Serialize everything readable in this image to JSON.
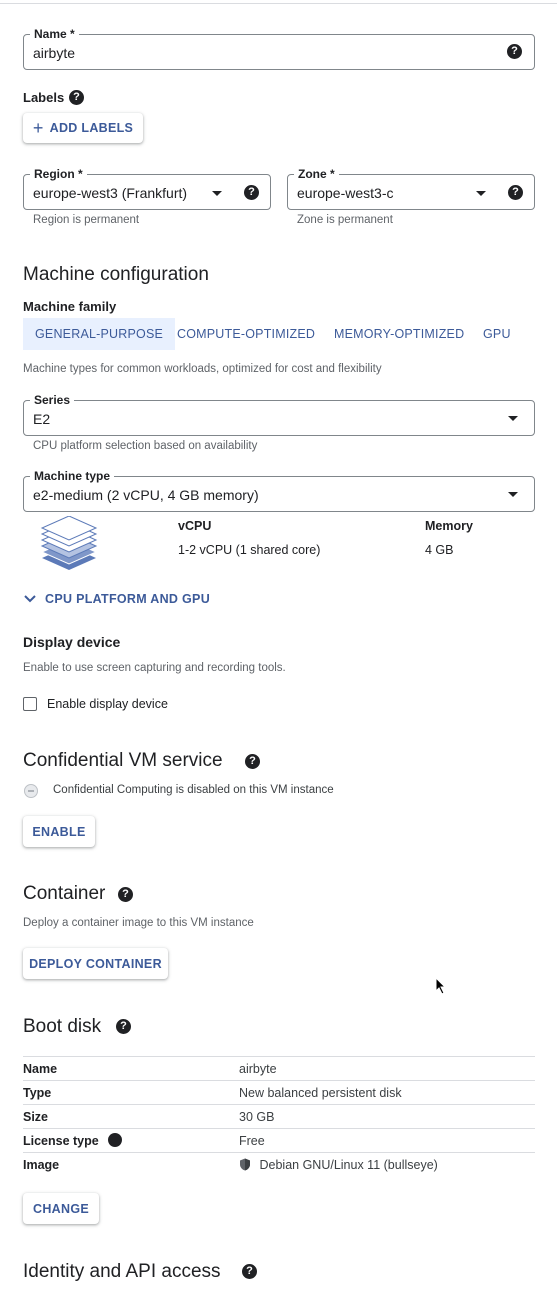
{
  "name_field": {
    "label": "Name *",
    "value": "airbyte",
    "help": "?"
  },
  "labels": {
    "title": "Labels",
    "help": "?",
    "add_button": "ADD LABELS"
  },
  "region": {
    "label": "Region *",
    "value": "europe-west3 (Frankfurt)",
    "hint": "Region is permanent",
    "help": "?"
  },
  "zone": {
    "label": "Zone *",
    "value": "europe-west3-c",
    "hint": "Zone is permanent",
    "help": "?"
  },
  "machine_config": {
    "title": "Machine configuration",
    "family_label": "Machine family",
    "tabs": [
      "GENERAL-PURPOSE",
      "COMPUTE-OPTIMIZED",
      "MEMORY-OPTIMIZED",
      "GPU"
    ],
    "family_desc": "Machine types for common workloads, optimized for cost and flexibility",
    "series": {
      "label": "Series",
      "value": "E2",
      "hint": "CPU platform selection based on availability"
    },
    "machine_type": {
      "label": "Machine type",
      "value": "e2-medium (2 vCPU, 4 GB memory)"
    },
    "spec": {
      "vcpu_header": "vCPU",
      "memory_header": "Memory",
      "vcpu_value": "1-2 vCPU (1 shared core)",
      "memory_value": "4 GB"
    },
    "cpu_platform_link": "CPU PLATFORM AND GPU"
  },
  "display_device": {
    "title": "Display device",
    "desc": "Enable to use screen capturing and recording tools.",
    "checkbox_label": "Enable display device",
    "checked": false
  },
  "confidential": {
    "title": "Confidential VM service",
    "help": "?",
    "status": "Confidential Computing is disabled on this VM instance",
    "enable_button": "ENABLE"
  },
  "container": {
    "title": "Container",
    "help": "?",
    "desc": "Deploy a container image to this VM instance",
    "deploy_button": "DEPLOY CONTAINER"
  },
  "boot_disk": {
    "title": "Boot disk",
    "help": "?",
    "rows": [
      {
        "key": "Name",
        "value": "airbyte"
      },
      {
        "key": "Type",
        "value": "New balanced persistent disk"
      },
      {
        "key": "Size",
        "value": "30 GB"
      },
      {
        "key": "License type",
        "value": "Free"
      },
      {
        "key": "Image",
        "value": "Debian GNU/Linux 11 (bullseye)"
      }
    ],
    "change_button": "CHANGE"
  },
  "identity": {
    "title": "Identity and API access",
    "help": "?"
  },
  "colors": {
    "accent": "#3c5a99",
    "tab_active_bg": "#e8f0fe",
    "text": "#202124",
    "muted": "#5f6368"
  }
}
